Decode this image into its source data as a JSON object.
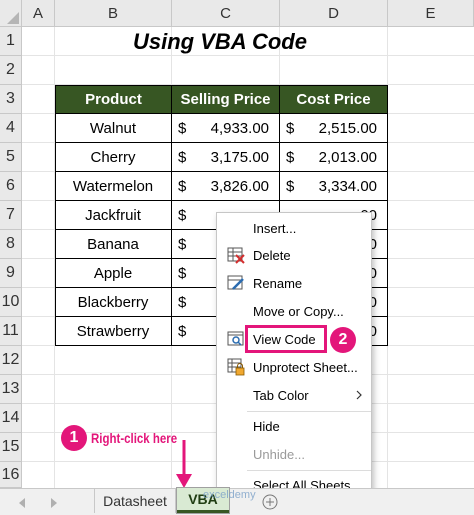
{
  "columns": [
    "A",
    "B",
    "C",
    "D",
    "E"
  ],
  "rows": [
    "1",
    "2",
    "3",
    "4",
    "5",
    "6",
    "7",
    "8",
    "9",
    "10",
    "11",
    "12",
    "13",
    "14",
    "15",
    "16"
  ],
  "title": "Using VBA Code",
  "table": {
    "headers": [
      "Product",
      "Selling Price",
      "Cost Price"
    ],
    "currency": "$",
    "rows": [
      {
        "product": "Walnut",
        "sell": "4,933.00",
        "cost": "2,515.00"
      },
      {
        "product": "Cherry",
        "sell": "3,175.00",
        "cost": "2,013.00"
      },
      {
        "product": "Watermelon",
        "sell": "3,826.00",
        "cost": "3,334.00"
      },
      {
        "product": "Jackfruit",
        "sell": "",
        "cost": "00"
      },
      {
        "product": "Banana",
        "sell": "",
        "cost": "00"
      },
      {
        "product": "Apple",
        "sell": "",
        "cost": "00"
      },
      {
        "product": "Blackberry",
        "sell": "",
        "cost": "00"
      },
      {
        "product": "Strawberry",
        "sell": "",
        "cost": "00"
      }
    ]
  },
  "context_menu": {
    "insert": "Insert...",
    "delete": "Delete",
    "rename": "Rename",
    "move_copy": "Move or Copy...",
    "view_code": "View Code",
    "unprotect": "Unprotect Sheet...",
    "tab_color": "Tab Color",
    "hide": "Hide",
    "unhide": "Unhide...",
    "select_all": "Select All Sheets"
  },
  "annotations": {
    "step1_number": "1",
    "step1_text": "Right-click here",
    "step2_number": "2"
  },
  "sheet_tabs": {
    "datasheet": "Datasheet",
    "vba": "VBA",
    "watermark": "exceldemy"
  },
  "colors": {
    "table_header_bg": "#375623",
    "annotation_pink": "#e3167a",
    "active_tab_bg": "#d9ead3"
  }
}
